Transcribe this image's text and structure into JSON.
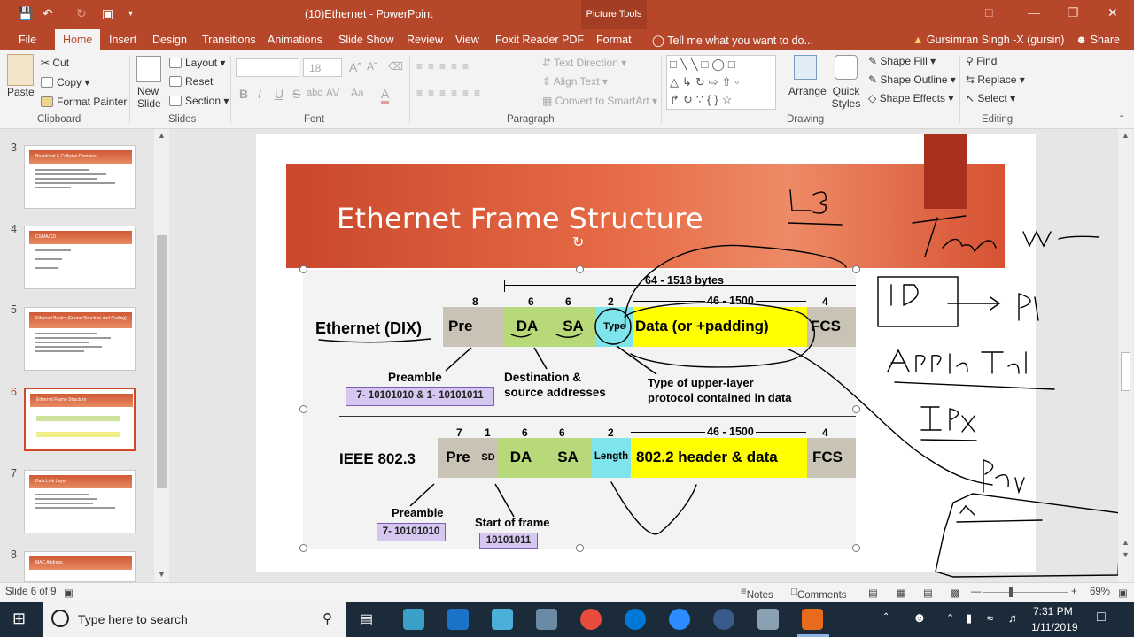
{
  "window": {
    "title": "(10)Ethernet - PowerPoint",
    "context_tab": "Picture Tools"
  },
  "tabs": [
    "File",
    "Home",
    "Insert",
    "Design",
    "Transitions",
    "Animations",
    "Slide Show",
    "Review",
    "View",
    "Foxit Reader PDF",
    "Format"
  ],
  "tell_me": "Tell me what you want to do...",
  "user": "Gursimran Singh -X (gursin)",
  "share": "Share",
  "ribbon": {
    "clipboard": {
      "paste": "Paste",
      "cut": "Cut",
      "copy": "Copy",
      "format_painter": "Format Painter",
      "label": "Clipboard"
    },
    "slides": {
      "new_slide": "New Slide",
      "layout": "Layout",
      "reset": "Reset",
      "section": "Section",
      "label": "Slides"
    },
    "font": {
      "font_size": "18",
      "label": "Font",
      "bold": "B",
      "italic": "I",
      "underline": "U",
      "strike": "S",
      "shadow": "abc",
      "spacing": "AV",
      "case": "Aa",
      "color": "A"
    },
    "paragraph": {
      "text_direction": "Text Direction",
      "align_text": "Align Text",
      "smartart": "Convert to SmartArt",
      "label": "Paragraph"
    },
    "drawing": {
      "arrange": "Arrange",
      "quick_styles": "Quick Styles",
      "shape_fill": "Shape Fill",
      "shape_outline": "Shape Outline",
      "shape_effects": "Shape Effects",
      "label": "Drawing"
    },
    "editing": {
      "find": "Find",
      "replace": "Replace",
      "select": "Select",
      "label": "Editing"
    }
  },
  "thumbnails": [
    {
      "num": "3",
      "title": "Broadcast & Collision Domains"
    },
    {
      "num": "4",
      "title": "CSMA/CD"
    },
    {
      "num": "5",
      "title": "Ethernet Basics (Frame Structure and Coding)"
    },
    {
      "num": "6",
      "title": "Ethernet Frame Structure"
    },
    {
      "num": "7",
      "title": "Data Link Layer"
    },
    {
      "num": "8",
      "title": "MAC Address"
    }
  ],
  "slide": {
    "title": "Ethernet Frame Structure",
    "dix": {
      "label": "Ethernet (DIX)",
      "total": "64 - 1518 bytes",
      "data_range": "46 - 1500",
      "sizes": [
        "8",
        "6",
        "6",
        "2",
        "4"
      ],
      "fields": [
        "Pre",
        "DA",
        "SA",
        "Type",
        "Data (or +padding)",
        "FCS"
      ],
      "preamble_label": "Preamble",
      "preamble_bits": "7- 10101010  &  1- 10101011",
      "dest_label": "Destination &",
      "dest_label2": "source addresses",
      "type_label": "Type of upper-layer",
      "type_label2": "protocol contained in data"
    },
    "ieee": {
      "label": "IEEE 802.3",
      "data_range": "46 - 1500",
      "sizes": [
        "7",
        "1",
        "6",
        "6",
        "2",
        "4"
      ],
      "fields": [
        "Pre",
        "SD",
        "DA",
        "SA",
        "Length",
        "802.2 header & data",
        "FCS"
      ],
      "preamble_label": "Preamble",
      "preamble_bits": "7- 10101010",
      "sof_label": "Start of frame",
      "sof_bits": "10101011"
    },
    "handwriting": [
      "L-3",
      "Type Where",
      "IP",
      "Apple Talk",
      "IPX",
      "Pay."
    ]
  },
  "status": {
    "slide_info": "Slide 6 of 9",
    "notes": "Notes",
    "comments": "Comments",
    "zoom": "69%",
    "zoom_level": 0.69
  },
  "taskbar": {
    "search_placeholder": "Type here to search",
    "time": "7:31 PM",
    "date": "1/11/2019"
  },
  "colors": {
    "accent": "#b7472a",
    "da_sa": "#b8d97a",
    "type": "#7fe5ec",
    "data": "#ffff00",
    "pre": "#c8c3b4",
    "preamble_box": "#d6c7f0"
  }
}
